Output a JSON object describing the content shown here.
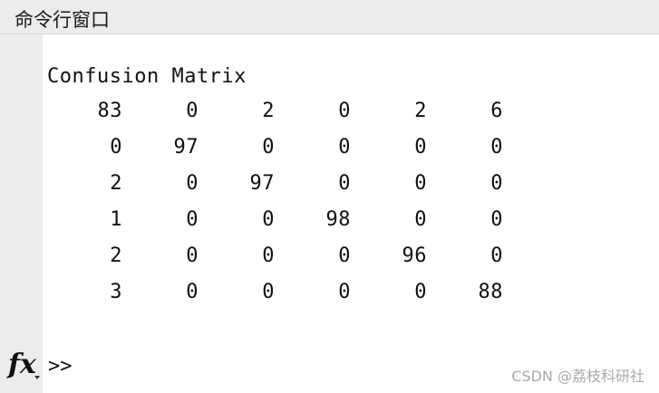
{
  "window": {
    "title": "命令行窗口"
  },
  "output": {
    "label": "Confusion Matrix",
    "matrix": [
      [
        "83",
        "0",
        "2",
        "0",
        "2",
        "6"
      ],
      [
        "0",
        "97",
        "0",
        "0",
        "0",
        "0"
      ],
      [
        "2",
        "0",
        "97",
        "0",
        "0",
        "0"
      ],
      [
        "1",
        "0",
        "0",
        "98",
        "0",
        "0"
      ],
      [
        "2",
        "0",
        "0",
        "0",
        "96",
        "0"
      ],
      [
        "3",
        "0",
        "0",
        "0",
        "0",
        "88"
      ]
    ]
  },
  "prompt": {
    "fx_symbol": "fx",
    "symbol": ">>"
  },
  "watermark": "CSDN @荔枝科研社"
}
